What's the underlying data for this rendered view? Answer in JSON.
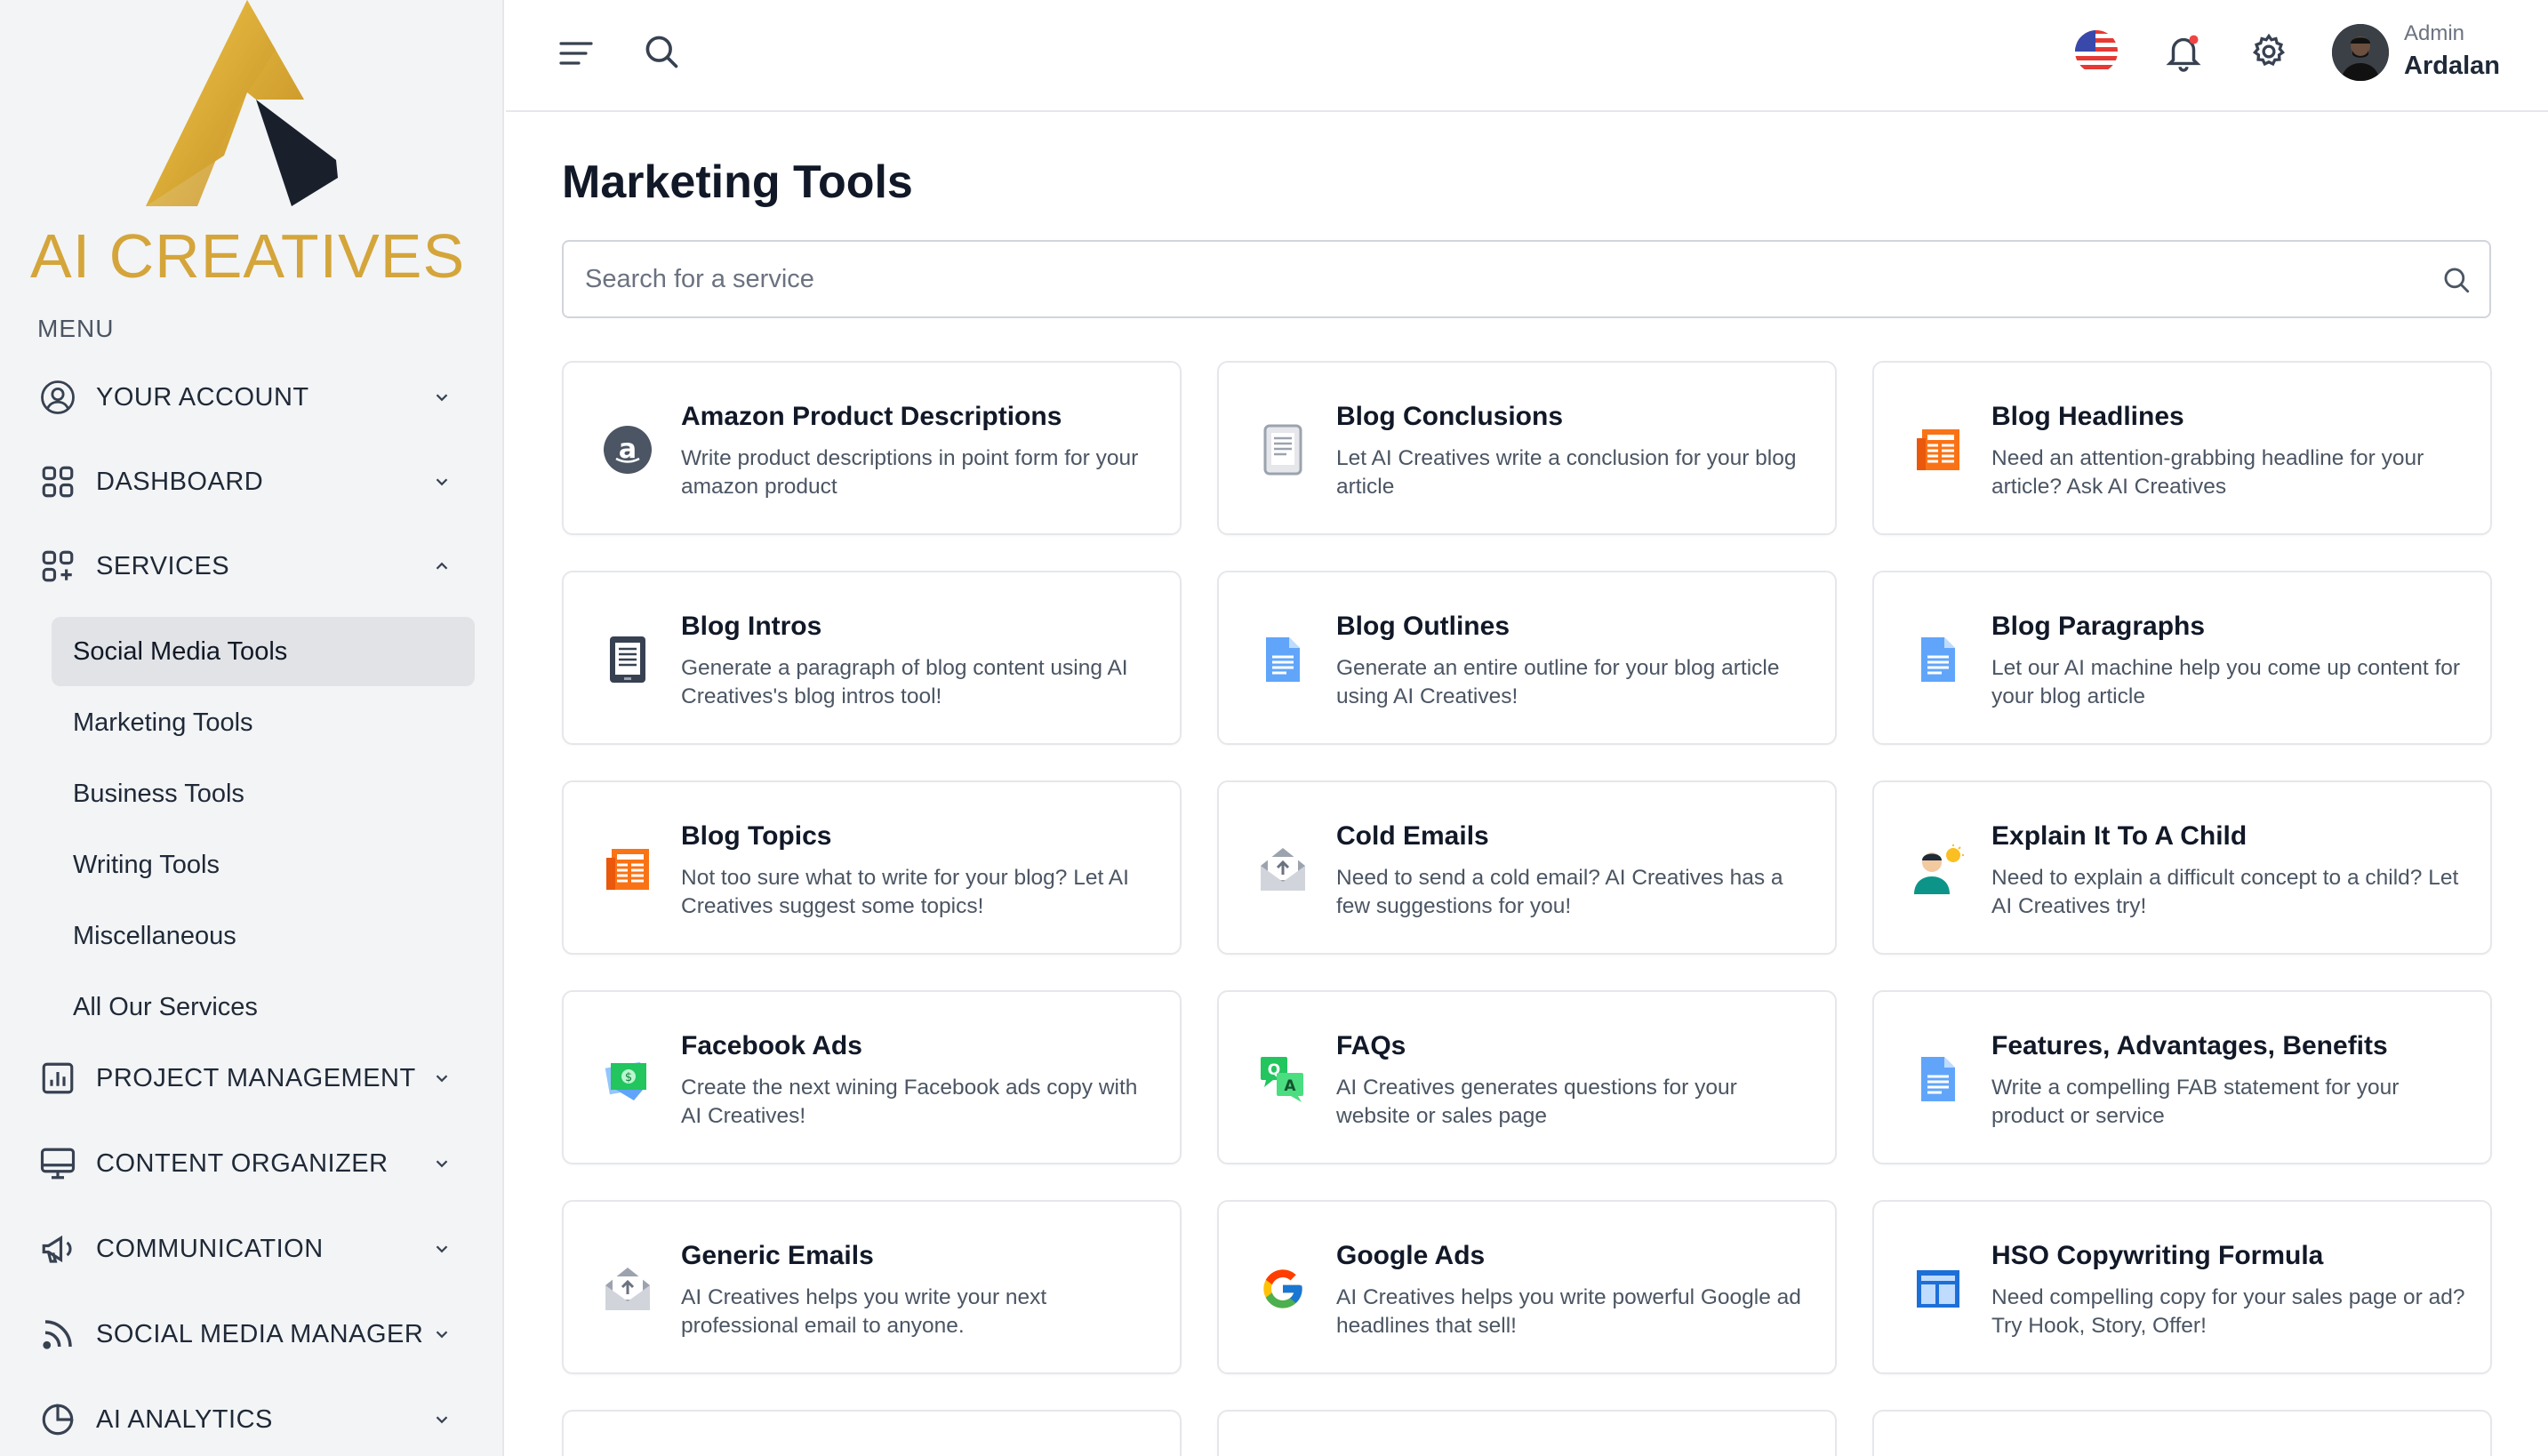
{
  "brand": {
    "name": "AI CREATIVES",
    "gold": "#d4a53a",
    "dark": "#1a1f2c"
  },
  "sidebar": {
    "menu_heading": "MENU",
    "items": [
      {
        "label": "YOUR ACCOUNT",
        "icon": "user-circle-icon",
        "expanded": false
      },
      {
        "label": "DASHBOARD",
        "icon": "grid-icon",
        "expanded": false
      },
      {
        "label": "SERVICES",
        "icon": "grid-plus-icon",
        "expanded": true
      },
      {
        "label": "PROJECT MANAGEMENT",
        "icon": "bar-chart-icon",
        "expanded": false
      },
      {
        "label": "CONTENT ORGANIZER",
        "icon": "monitor-icon",
        "expanded": false
      },
      {
        "label": "COMMUNICATION",
        "icon": "megaphone-icon",
        "expanded": false
      },
      {
        "label": "SOCIAL MEDIA MANAGER",
        "icon": "rss-icon",
        "expanded": false
      },
      {
        "label": "AI ANALYTICS",
        "icon": "pie-chart-icon",
        "expanded": false
      }
    ],
    "services_sub": [
      {
        "label": "Social Media Tools",
        "active": true
      },
      {
        "label": "Marketing Tools",
        "active": false
      },
      {
        "label": "Business Tools",
        "active": false
      },
      {
        "label": "Writing Tools",
        "active": false
      },
      {
        "label": "Miscellaneous",
        "active": false
      },
      {
        "label": "All Our Services",
        "active": false
      }
    ]
  },
  "header": {
    "icons": [
      "menu-icon",
      "search-icon",
      "us-flag-icon",
      "bell-icon",
      "gear-icon"
    ],
    "notification_dot_color": "#ef4444",
    "user": {
      "role": "Admin",
      "name": "Ardalan"
    }
  },
  "main": {
    "title": "Marketing Tools",
    "search": {
      "placeholder": "Search for a service",
      "value": ""
    },
    "cards": [
      {
        "title": "Amazon Product Descriptions",
        "desc": "Write product descriptions in point form for your amazon product",
        "icon": "amazon-icon"
      },
      {
        "title": "Blog Conclusions",
        "desc": "Let AI Creatives write a conclusion for your blog article",
        "icon": "document-gray-icon"
      },
      {
        "title": "Blog Headlines",
        "desc": "Need an attention-grabbing headline for your article? Ask AI Creatives",
        "icon": "newspaper-icon"
      },
      {
        "title": "Blog Intros",
        "desc": "Generate a paragraph of blog content using AI Creatives's blog intros tool!",
        "icon": "notepad-icon"
      },
      {
        "title": "Blog Outlines",
        "desc": "Generate an entire outline for your blog article using AI Creatives!",
        "icon": "document-blue-icon"
      },
      {
        "title": "Blog Paragraphs",
        "desc": "Let our AI machine help you come up content for your blog article",
        "icon": "document-blue-icon"
      },
      {
        "title": "Blog Topics",
        "desc": "Not too sure what to write for your blog? Let AI Creatives suggest some topics!",
        "icon": "newspaper-icon"
      },
      {
        "title": "Cold Emails",
        "desc": "Need to send a cold email? AI Creatives has a few suggestions for you!",
        "icon": "mail-open-icon"
      },
      {
        "title": "Explain It To A Child",
        "desc": "Need to explain a difficult concept to a child? Let AI Creatives try!",
        "icon": "person-idea-icon"
      },
      {
        "title": "Facebook Ads",
        "desc": "Create the next wining Facebook ads copy with AI Creatives!",
        "icon": "money-ad-icon"
      },
      {
        "title": "FAQs",
        "desc": "AI Creatives generates questions for your website or sales page",
        "icon": "qa-icon"
      },
      {
        "title": "Features, Advantages, Benefits",
        "desc": "Write a compelling FAB statement for your product or service",
        "icon": "document-blue-icon"
      },
      {
        "title": "Generic Emails",
        "desc": "AI Creatives helps you write your next professional email to anyone.",
        "icon": "mail-open-icon"
      },
      {
        "title": "Google Ads",
        "desc": "AI Creatives helps you write powerful Google ad headlines that sell!",
        "icon": "google-icon"
      },
      {
        "title": "HSO Copywriting Formula",
        "desc": "Need compelling copy for your sales page or ad? Try Hook, Story, Offer!",
        "icon": "layout-icon"
      },
      {
        "title": "",
        "desc": "",
        "icon": ""
      },
      {
        "title": "",
        "desc": "",
        "icon": ""
      },
      {
        "title": "",
        "desc": "",
        "icon": ""
      }
    ]
  }
}
